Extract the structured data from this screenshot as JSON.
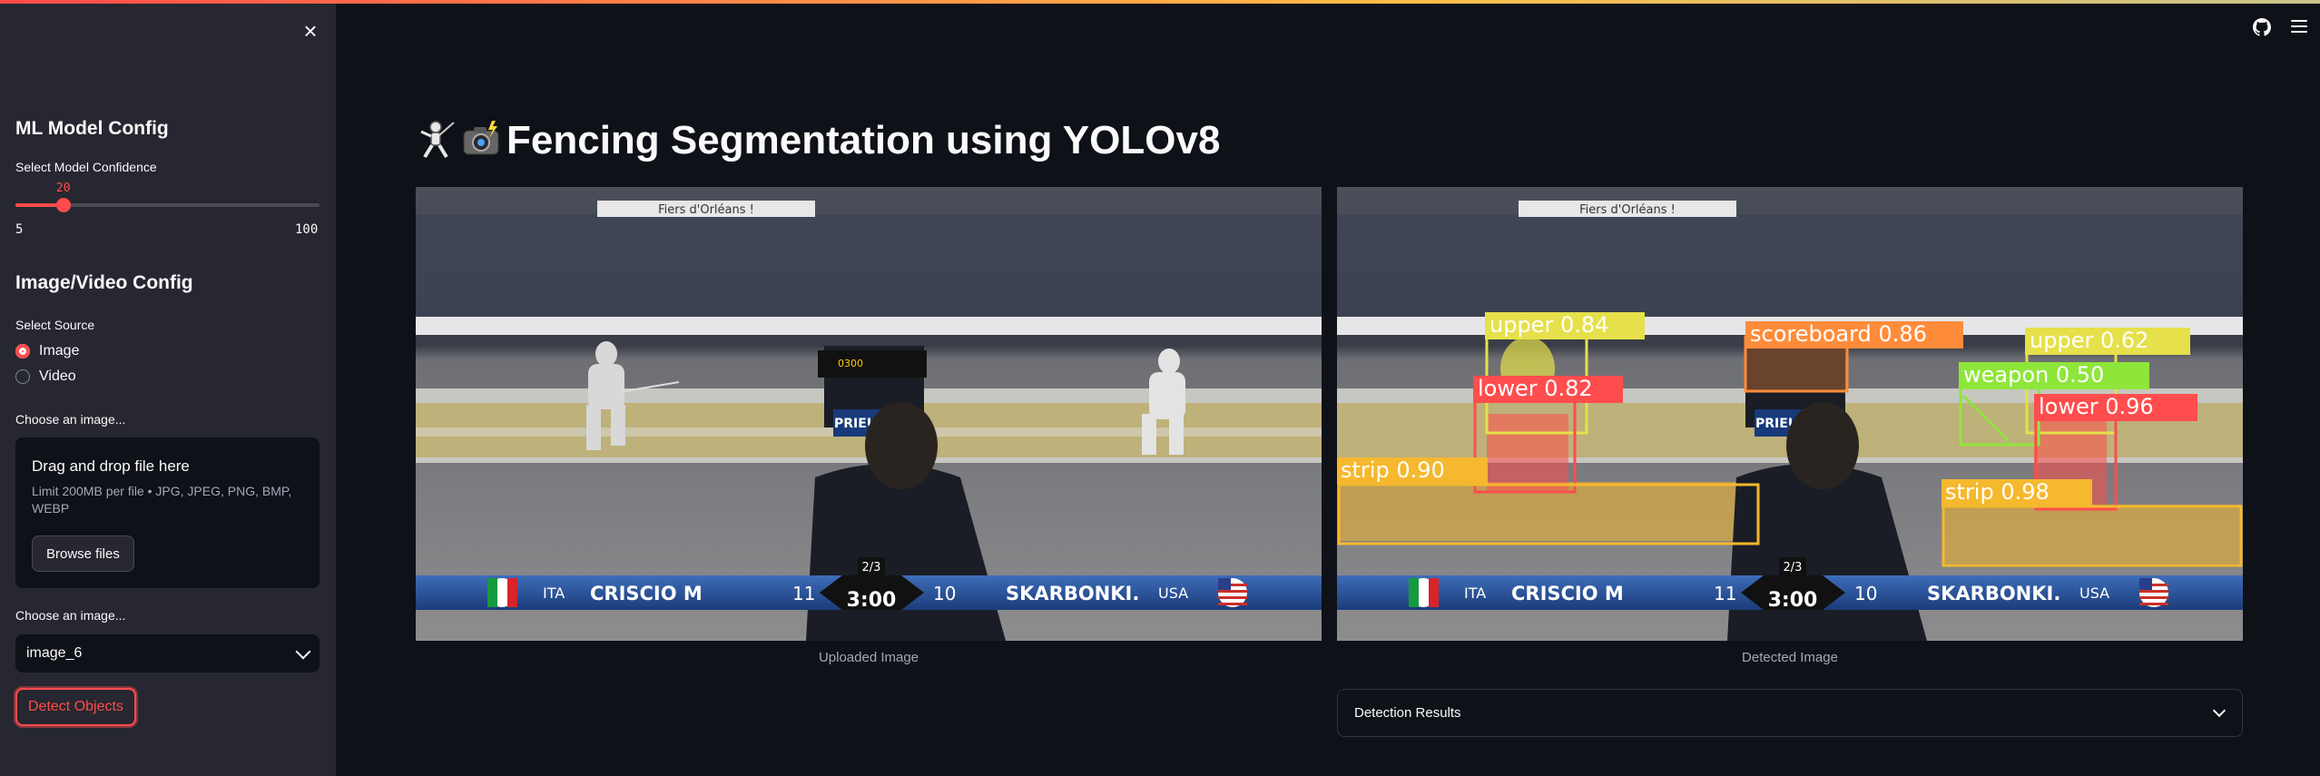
{
  "sidebar": {
    "close_icon": "close-icon",
    "model_config_heading": "ML Model Config",
    "confidence_label": "Select Model Confidence",
    "confidence": {
      "value": 20,
      "min": 5,
      "max": 100,
      "value_text": "20",
      "min_text": "5",
      "max_text": "100"
    },
    "source_config_heading": "Image/Video Config",
    "source_label": "Select Source",
    "source_options": [
      {
        "label": "Image",
        "selected": true
      },
      {
        "label": "Video",
        "selected": false
      }
    ],
    "uploader_label": "Choose an image...",
    "uploader": {
      "title": "Drag and drop file here",
      "limit": "Limit 200MB per file • JPG, JPEG, PNG, BMP, WEBP",
      "browse_label": "Browse files"
    },
    "select_label": "Choose an image...",
    "select_value": "image_6",
    "detect_label": "Detect Objects"
  },
  "header": {
    "github_icon": "github-icon",
    "menu_icon": "hamburger-menu-icon"
  },
  "main": {
    "title": "Fencing Segmentation using YOLOv8",
    "uploaded_caption": "Uploaded Image",
    "detected_caption": "Detected Image",
    "expander_label": "Detection Results"
  },
  "scene": {
    "banner": "Fiers d'Orléans !",
    "sponsor": "PRIEUR",
    "score_box": {
      "round": "2/3",
      "time": "3:00"
    },
    "left_fencer": {
      "country": "ITA",
      "name": "CRISCIO M",
      "score": "11"
    },
    "right_fencer": {
      "country": "USA",
      "name": "SKARBONKI.",
      "score": "10"
    }
  },
  "detections": [
    {
      "label": "upper 0.84",
      "color": "#e6e04a"
    },
    {
      "label": "lower 0.82",
      "color": "#ff4d4d"
    },
    {
      "label": "strip 0.90",
      "color": "#f5b82e"
    },
    {
      "label": "scoreboard 0.86",
      "color": "#ff8c3a"
    },
    {
      "label": "upper 0.62",
      "color": "#e6e04a"
    },
    {
      "label": "weapon 0.50",
      "color": "#8ee63a"
    },
    {
      "label": "lower 0.96",
      "color": "#ff4d4d"
    },
    {
      "label": "strip 0.98",
      "color": "#f5b82e"
    }
  ],
  "colors": {
    "accent": "#ff4b4b",
    "sidebar_bg": "#262730",
    "app_bg": "#0e1117"
  }
}
